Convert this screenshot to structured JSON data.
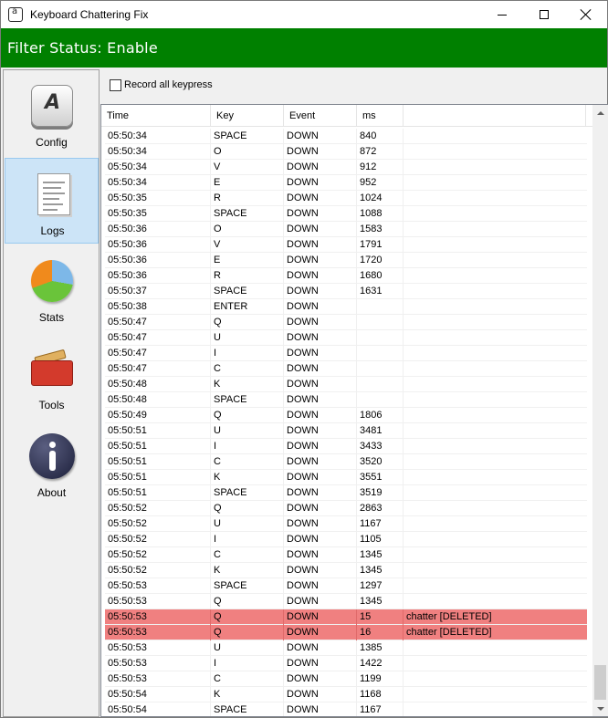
{
  "window": {
    "title": "Keyboard Chattering Fix"
  },
  "status": {
    "text": "Filter Status: Enable",
    "color": "#008000"
  },
  "sidebar": {
    "items": [
      {
        "label": "Config",
        "icon": "keycap-a-icon",
        "active": false
      },
      {
        "label": "Logs",
        "icon": "document-icon",
        "active": true
      },
      {
        "label": "Stats",
        "icon": "pie-chart-icon",
        "active": false
      },
      {
        "label": "Tools",
        "icon": "toolbox-icon",
        "active": false
      },
      {
        "label": "About",
        "icon": "info-icon",
        "active": false
      }
    ]
  },
  "options": {
    "record_all_label": "Record all keypress",
    "record_all_checked": false
  },
  "table": {
    "columns": [
      "Time",
      "Key",
      "Event",
      "ms",
      ""
    ],
    "chatter_color": "#f08080",
    "rows": [
      [
        "05:50:34",
        "SPACE",
        "DOWN",
        "840",
        ""
      ],
      [
        "05:50:34",
        "O",
        "DOWN",
        "872",
        ""
      ],
      [
        "05:50:34",
        "V",
        "DOWN",
        "912",
        ""
      ],
      [
        "05:50:34",
        "E",
        "DOWN",
        "952",
        ""
      ],
      [
        "05:50:35",
        "R",
        "DOWN",
        "1024",
        ""
      ],
      [
        "05:50:35",
        "SPACE",
        "DOWN",
        "1088",
        ""
      ],
      [
        "05:50:36",
        "O",
        "DOWN",
        "1583",
        ""
      ],
      [
        "05:50:36",
        "V",
        "DOWN",
        "1791",
        ""
      ],
      [
        "05:50:36",
        "E",
        "DOWN",
        "1720",
        ""
      ],
      [
        "05:50:36",
        "R",
        "DOWN",
        "1680",
        ""
      ],
      [
        "05:50:37",
        "SPACE",
        "DOWN",
        "1631",
        ""
      ],
      [
        "05:50:38",
        "ENTER",
        "DOWN",
        "",
        ""
      ],
      [
        "05:50:47",
        "Q",
        "DOWN",
        "",
        ""
      ],
      [
        "05:50:47",
        "U",
        "DOWN",
        "",
        ""
      ],
      [
        "05:50:47",
        "I",
        "DOWN",
        "",
        ""
      ],
      [
        "05:50:47",
        "C",
        "DOWN",
        "",
        ""
      ],
      [
        "05:50:48",
        "K",
        "DOWN",
        "",
        ""
      ],
      [
        "05:50:48",
        "SPACE",
        "DOWN",
        "",
        ""
      ],
      [
        "05:50:49",
        "Q",
        "DOWN",
        "1806",
        ""
      ],
      [
        "05:50:51",
        "U",
        "DOWN",
        "3481",
        ""
      ],
      [
        "05:50:51",
        "I",
        "DOWN",
        "3433",
        ""
      ],
      [
        "05:50:51",
        "C",
        "DOWN",
        "3520",
        ""
      ],
      [
        "05:50:51",
        "K",
        "DOWN",
        "3551",
        ""
      ],
      [
        "05:50:51",
        "SPACE",
        "DOWN",
        "3519",
        ""
      ],
      [
        "05:50:52",
        "Q",
        "DOWN",
        "2863",
        ""
      ],
      [
        "05:50:52",
        "U",
        "DOWN",
        "1167",
        ""
      ],
      [
        "05:50:52",
        "I",
        "DOWN",
        "1105",
        ""
      ],
      [
        "05:50:52",
        "C",
        "DOWN",
        "1345",
        ""
      ],
      [
        "05:50:52",
        "K",
        "DOWN",
        "1345",
        ""
      ],
      [
        "05:50:53",
        "SPACE",
        "DOWN",
        "1297",
        ""
      ],
      [
        "05:50:53",
        "Q",
        "DOWN",
        "1345",
        ""
      ],
      [
        "05:50:53",
        "Q",
        "DOWN",
        "15",
        "chatter [DELETED]"
      ],
      [
        "05:50:53",
        "Q",
        "DOWN",
        "16",
        "chatter [DELETED]"
      ],
      [
        "05:50:53",
        "U",
        "DOWN",
        "1385",
        ""
      ],
      [
        "05:50:53",
        "I",
        "DOWN",
        "1422",
        ""
      ],
      [
        "05:50:53",
        "C",
        "DOWN",
        "1199",
        ""
      ],
      [
        "05:50:54",
        "K",
        "DOWN",
        "1168",
        ""
      ],
      [
        "05:50:54",
        "SPACE",
        "DOWN",
        "1167",
        ""
      ]
    ]
  }
}
